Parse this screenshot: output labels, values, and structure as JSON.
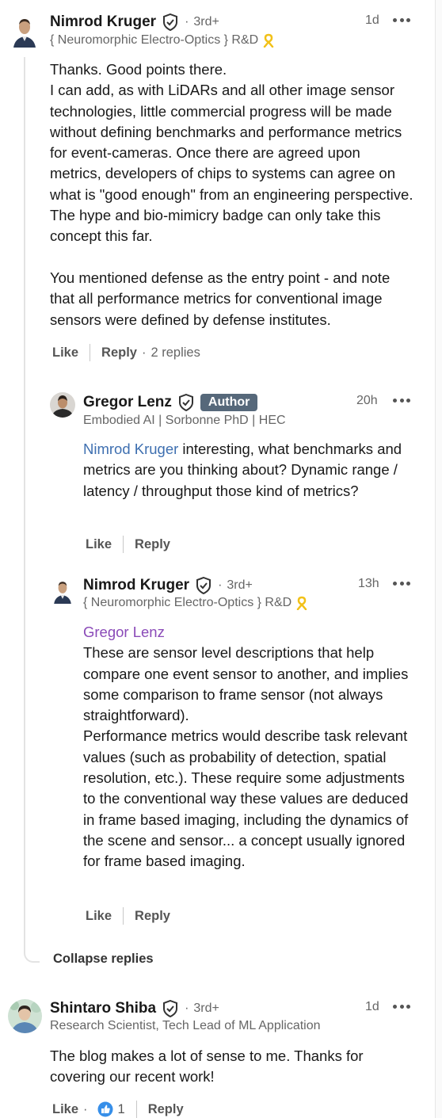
{
  "comments": [
    {
      "author": "Nimrod Kruger",
      "degree": "3rd+",
      "headline": "{ Neuromorphic Electro-Optics } R&D",
      "time": "1d",
      "paragraphs": [
        "Thanks. Good points there.",
        "I can add, as with LiDARs and all other image sensor technologies, little commercial progress will be made without defining benchmarks and performance metrics for event-cameras. Once there are agreed upon metrics, developers of chips to systems can agree on what is \"good enough\" from an engineering perspective. The hype and bio-mimicry badge can only take this concept this far.",
        "",
        "You mentioned defense as the entry point - and note that all performance metrics for conventional image sensors were defined by defense institutes."
      ],
      "like_label": "Like",
      "reply_label": "Reply",
      "replies_count": "2 replies"
    },
    {
      "author": "Gregor Lenz",
      "badge": "Author",
      "headline": "Embodied AI | Sorbonne PhD | HEC",
      "time": "20h",
      "mention": "Nimrod Kruger",
      "text": " interesting, what benchmarks and metrics are you thinking about? Dynamic range / latency / throughput those kind of metrics?",
      "like_label": "Like",
      "reply_label": "Reply"
    },
    {
      "author": "Nimrod Kruger",
      "degree": "3rd+",
      "headline": "{ Neuromorphic Electro-Optics } R&D",
      "time": "13h",
      "mention": "Gregor Lenz",
      "paragraphs": [
        "These are sensor level descriptions that help compare one event sensor to another, and implies some comparison to frame sensor (not always straightforward).",
        "Performance metrics would describe task relevant values (such as probability of detection, spatial resolution, etc.). These require some adjustments to the conventional way these values are deduced in frame based imaging, including the dynamics of the scene and sensor... a concept usually ignored for frame based imaging."
      ],
      "like_label": "Like",
      "reply_label": "Reply"
    },
    {
      "author": "Shintaro Shiba",
      "degree": "3rd+",
      "headline": "Research Scientist, Tech Lead of ML Application",
      "time": "1d",
      "text": "The blog makes a lot of sense to me. Thanks for covering our recent work!",
      "like_label": "Like",
      "reaction_count": "1",
      "reply_label": "Reply"
    }
  ],
  "collapse_label": "Collapse replies",
  "separator_dot": "·",
  "colors": {
    "mention_blue": "#3e6fb0",
    "mention_purple": "#8a4ab8",
    "author_badge": "#56687a",
    "reaction_blue": "#378fe9"
  },
  "icons": {
    "verified": "shield-check-icon",
    "ribbon": "yellow-ribbon-icon",
    "more": "more-horizontal-icon",
    "reaction": "thumbs-up-icon"
  }
}
